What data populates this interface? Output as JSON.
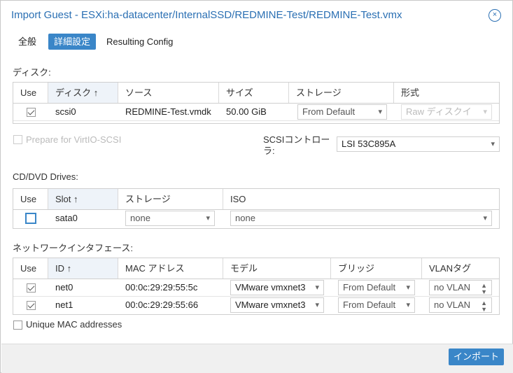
{
  "dialog": {
    "title": "Import Guest - ESXi:ha-datacenter/InternalSSD/REDMINE-Test/REDMINE-Test.vmx",
    "close_icon": "×"
  },
  "tabs": [
    {
      "label": "全般"
    },
    {
      "label": "詳細設定",
      "active": true
    },
    {
      "label": "Resulting Config"
    }
  ],
  "disks": {
    "section_label": "ディスク:",
    "columns": [
      "Use",
      "ディスク ↑",
      "ソース",
      "サイズ",
      "ストレージ",
      "形式"
    ],
    "rows": [
      {
        "use": true,
        "disk": "scsi0",
        "source": "REDMINE-Test.vmdk",
        "size": "50.00 GiB",
        "storage": "From Default",
        "format": "Raw ディスクイ"
      }
    ]
  },
  "virtio": {
    "label": "Prepare for VirtIO-SCSI",
    "checked": false
  },
  "scsi": {
    "label": "SCSIコントローラ:",
    "label_line1": "SCSIコントロー",
    "label_line2": "ラ:",
    "value": "LSI 53C895A"
  },
  "cd": {
    "section_label": "CD/DVD Drives:",
    "columns": [
      "Use",
      "Slot ↑",
      "ストレージ",
      "ISO"
    ],
    "rows": [
      {
        "use": false,
        "slot": "sata0",
        "storage": "none",
        "iso": "none"
      }
    ]
  },
  "net": {
    "section_label": "ネットワークインタフェース:",
    "columns": [
      "Use",
      "ID ↑",
      "MAC アドレス",
      "モデル",
      "ブリッジ",
      "VLANタグ"
    ],
    "rows": [
      {
        "use": true,
        "id": "net0",
        "mac": "00:0c:29:29:55:5c",
        "model": "VMware vmxnet3",
        "bridge": "From Default",
        "vlan": "no VLAN"
      },
      {
        "use": true,
        "id": "net1",
        "mac": "00:0c:29:29:55:66",
        "model": "VMware vmxnet3",
        "bridge": "From Default",
        "vlan": "no VLAN"
      }
    ]
  },
  "unique_mac": {
    "label": "Unique MAC addresses",
    "checked": false
  },
  "footer": {
    "import_label": "インポート"
  },
  "colors": {
    "accent": "#3a86c8",
    "title": "#2a6fb3"
  },
  "icons": {
    "dropdown": "chevron-down-icon",
    "spinner": "spinner-arrows-icon",
    "close": "close-circle-icon",
    "checkbox": "checkbox-icon"
  }
}
